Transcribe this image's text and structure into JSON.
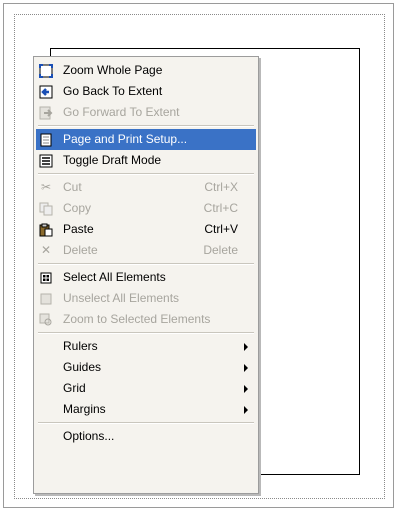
{
  "menu": {
    "items": [
      {
        "label": "Zoom Whole Page",
        "icon": "zoom-page-icon"
      },
      {
        "label": "Go Back To Extent",
        "icon": "back-arrow-icon"
      },
      {
        "label": "Go Forward To Extent",
        "icon": "forward-arrow-icon",
        "disabled": true
      },
      {
        "label": "Page and Print Setup...",
        "icon": "page-setup-icon",
        "highlighted": true
      },
      {
        "label": "Toggle Draft Mode",
        "icon": "draft-mode-icon"
      },
      {
        "label": "Cut",
        "shortcut": "Ctrl+X",
        "icon": "scissors-icon",
        "disabled": true
      },
      {
        "label": "Copy",
        "shortcut": "Ctrl+C",
        "icon": "copy-icon",
        "disabled": true
      },
      {
        "label": "Paste",
        "shortcut": "Ctrl+V",
        "icon": "paste-icon"
      },
      {
        "label": "Delete",
        "shortcut": "Delete",
        "icon": "delete-icon",
        "disabled": true
      },
      {
        "label": "Select All Elements",
        "icon": "select-all-icon"
      },
      {
        "label": "Unselect All Elements",
        "icon": "unselect-icon",
        "disabled": true
      },
      {
        "label": "Zoom to Selected Elements",
        "icon": "zoom-selected-icon",
        "disabled": true
      },
      {
        "label": "Rulers",
        "submenu": true
      },
      {
        "label": "Guides",
        "submenu": true
      },
      {
        "label": "Grid",
        "submenu": true
      },
      {
        "label": "Margins",
        "submenu": true
      },
      {
        "label": "Options..."
      }
    ]
  },
  "colors": {
    "highlight": "#3a72c6",
    "disabled_text": "#a7a59e",
    "menu_bg": "#f5f3ee"
  }
}
